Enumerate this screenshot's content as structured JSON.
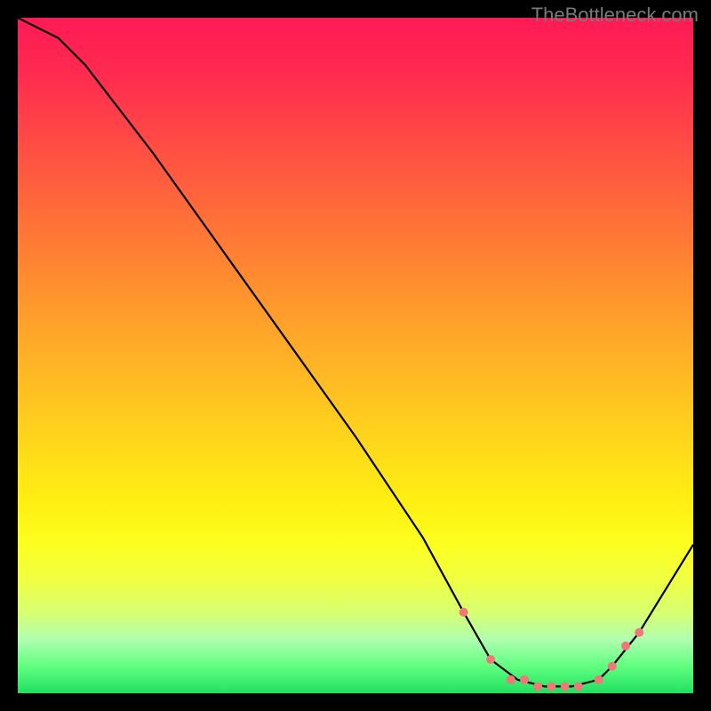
{
  "watermark": "TheBottleneck.com",
  "chart_data": {
    "type": "line",
    "title": "",
    "xlabel": "",
    "ylabel": "",
    "xlim": [
      0,
      100
    ],
    "ylim": [
      0,
      100
    ],
    "series": [
      {
        "name": "curve",
        "x": [
          0,
          6,
          10,
          20,
          30,
          40,
          50,
          60,
          66,
          70,
          74,
          78,
          82,
          86,
          88,
          92,
          100
        ],
        "values": [
          100,
          97,
          93,
          80,
          66,
          52,
          38,
          23,
          12,
          5,
          2,
          1,
          1,
          2,
          4,
          9,
          22
        ]
      }
    ],
    "markers": {
      "name": "bottleneck-range-dots",
      "x": [
        66,
        70,
        73,
        75,
        77,
        79,
        81,
        83,
        86,
        88,
        90,
        92
      ],
      "values": [
        12,
        5,
        2,
        2,
        1,
        1,
        1,
        1,
        2,
        4,
        7,
        9
      ],
      "color": "#f07878"
    },
    "background": {
      "type": "vertical-gradient",
      "stops": [
        {
          "pos": 0,
          "color": "#ff1a55"
        },
        {
          "pos": 18,
          "color": "#ff4a45"
        },
        {
          "pos": 38,
          "color": "#ff8a30"
        },
        {
          "pos": 58,
          "color": "#ffc820"
        },
        {
          "pos": 78,
          "color": "#fbff20"
        },
        {
          "pos": 92,
          "color": "#b0ffb0"
        },
        {
          "pos": 100,
          "color": "#20e060"
        }
      ]
    }
  }
}
